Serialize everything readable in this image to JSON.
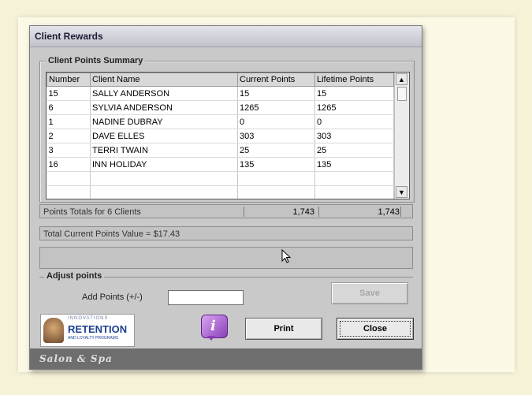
{
  "window": {
    "title": "Client Rewards"
  },
  "summary": {
    "legend": "Client Points Summary",
    "columns": [
      "Number",
      "Client Name",
      "Current Points",
      "Lifetime Points"
    ],
    "rows": [
      [
        "15",
        "SALLY ANDERSON",
        "15",
        "15"
      ],
      [
        "6",
        "SYLVIA ANDERSON",
        "1265",
        "1265"
      ],
      [
        "1",
        "NADINE DUBRAY",
        "0",
        "0"
      ],
      [
        "2",
        "DAVE ELLES",
        "303",
        "303"
      ],
      [
        "3",
        "TERRI TWAIN",
        "25",
        "25"
      ],
      [
        "16",
        "INN HOLIDAY",
        "135",
        "135"
      ],
      [
        "",
        "",
        "",
        ""
      ],
      [
        "",
        "",
        "",
        ""
      ]
    ]
  },
  "totals": {
    "label": "Points Totals for 6 Clients",
    "current": "1,743",
    "lifetime": "1,743"
  },
  "value_line": "Total Current Points Value = $17.43",
  "adjust": {
    "legend": "Adjust points",
    "add_label": "Add Points (+/-)",
    "add_value": "",
    "save_label": "Save"
  },
  "buttons": {
    "print": "Print",
    "close": "Close",
    "info": "i"
  },
  "logo": {
    "title": "RETENTION",
    "subtitle": "AND LOYALTY PROGRAMS",
    "top": "INNOVATIONS"
  },
  "brand": "Salon & Spa",
  "colors": {
    "info_purple": "#8b3fb8",
    "logo_blue": "#1b3f8f",
    "brand_bar": "#6e6e6e"
  }
}
